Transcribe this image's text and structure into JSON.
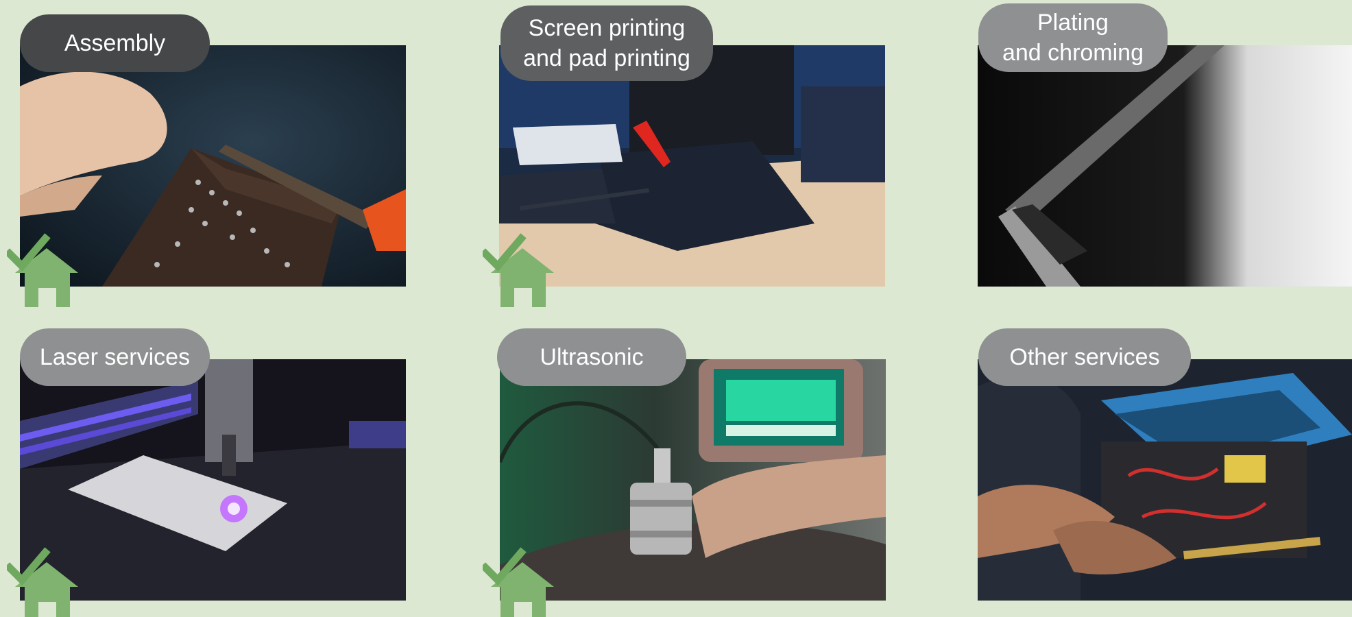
{
  "colors": {
    "background": "#dce8d1",
    "label_dark": "#454749",
    "label_mid": "#6f7173",
    "label_light": "#8e9091",
    "badge_green": "#7fb36f",
    "check_green": "#6fa85f"
  },
  "services": [
    {
      "id": "assembly",
      "label": "Assembly",
      "label_lines": [
        "Assembly"
      ],
      "badge": "home-check-icon"
    },
    {
      "id": "screen-printing",
      "label": "Screen printing and pad printing",
      "label_lines": [
        "Screen printing",
        "and pad printing"
      ],
      "badge": "home-check-icon"
    },
    {
      "id": "plating",
      "label": "Plating and chroming",
      "label_lines": [
        "Plating",
        "and chroming"
      ],
      "badge": ""
    },
    {
      "id": "laser",
      "label": "Laser services",
      "label_lines": [
        "Laser services"
      ],
      "badge": "home-check-icon"
    },
    {
      "id": "ultrasonic",
      "label": "Ultrasonic",
      "label_lines": [
        "Ultrasonic"
      ],
      "badge": "home-check-icon"
    },
    {
      "id": "other",
      "label": "Other services",
      "label_lines": [
        "Other services"
      ],
      "badge": ""
    }
  ]
}
